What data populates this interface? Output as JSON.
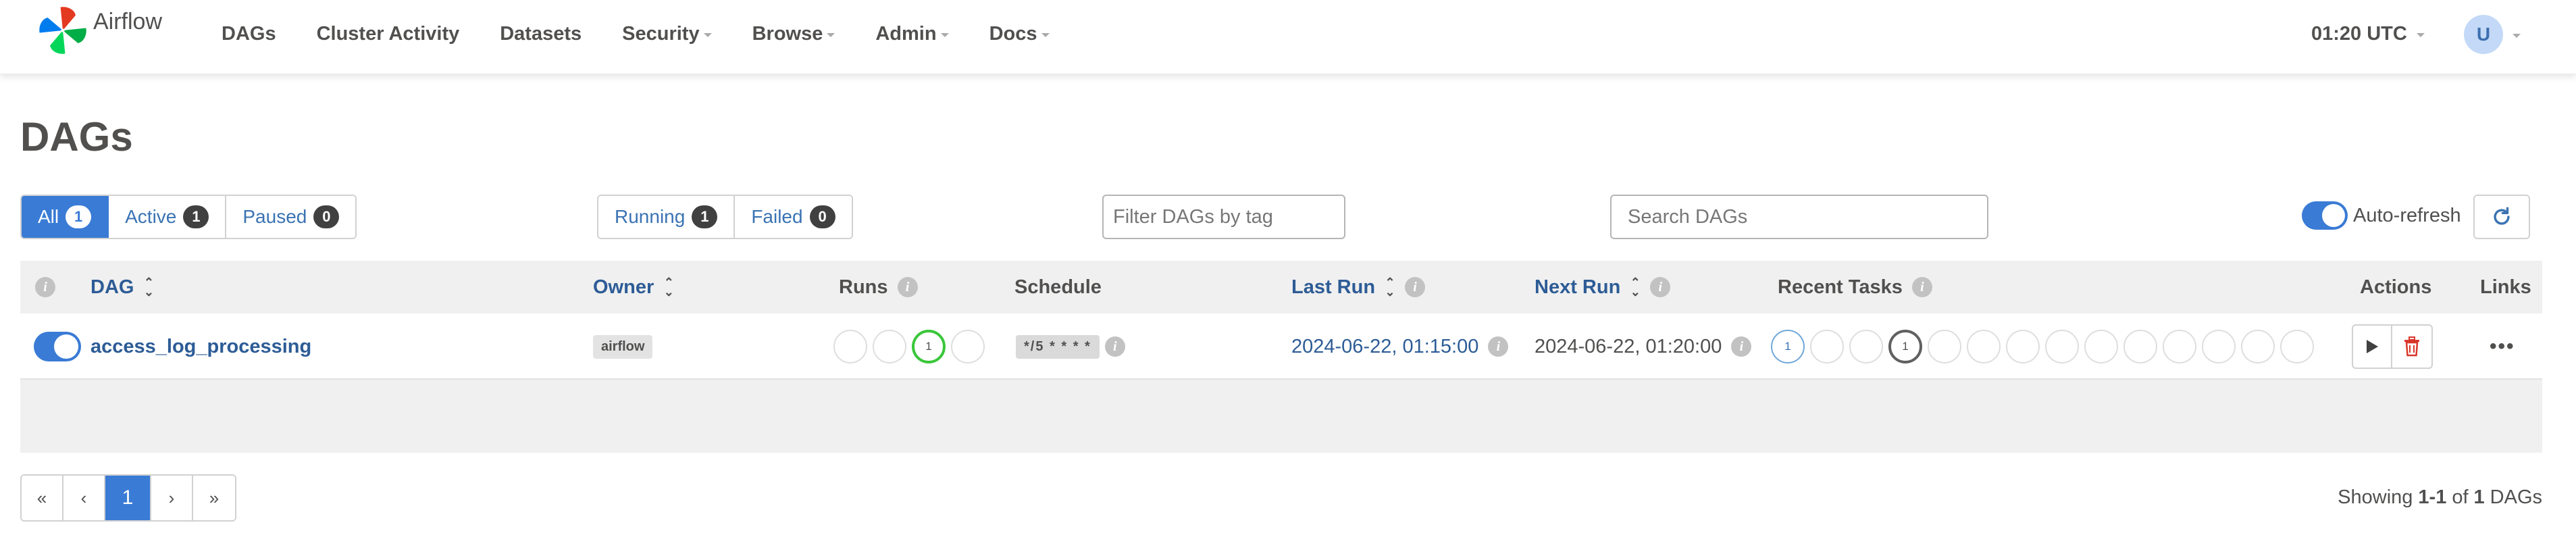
{
  "navbar": {
    "brand": "Airflow",
    "items": [
      "DAGs",
      "Cluster Activity",
      "Datasets",
      "Security",
      "Browse",
      "Admin",
      "Docs"
    ],
    "time": "01:20 UTC",
    "avatar_initial": "U",
    "colors": {
      "accent": "#3a7bd5",
      "link": "#2d5c96"
    }
  },
  "page_title": "DAGs",
  "status_filters": {
    "all": {
      "label": "All",
      "count": "1"
    },
    "active": {
      "label": "Active",
      "count": "1"
    },
    "paused": {
      "label": "Paused",
      "count": "0"
    }
  },
  "run_filters": {
    "running": {
      "label": "Running",
      "count": "1"
    },
    "failed": {
      "label": "Failed",
      "count": "0"
    }
  },
  "tag_filter": {
    "placeholder": "Filter DAGs by tag"
  },
  "search": {
    "placeholder": "Search DAGs"
  },
  "auto_refresh": {
    "label": "Auto-refresh",
    "enabled": true
  },
  "table": {
    "headers": {
      "dag": "DAG",
      "owner": "Owner",
      "runs": "Runs",
      "schedule": "Schedule",
      "last_run": "Last Run",
      "next_run": "Next Run",
      "recent_tasks": "Recent Tasks",
      "actions": "Actions",
      "links": "Links"
    },
    "rows": [
      {
        "enabled": true,
        "dag_id": "access_log_processing",
        "owner": "airflow",
        "runs": [
          "",
          "",
          "1",
          ""
        ],
        "runs_states": [
          "none",
          "none",
          "success",
          "none"
        ],
        "schedule": "*/5 * * * *",
        "last_run": "2024-06-22, 01:15:00",
        "next_run": "2024-06-22, 01:20:00",
        "recent_tasks": [
          "1",
          "",
          "",
          "1",
          "",
          "",
          "",
          "",
          "",
          "",
          "",
          "",
          "",
          ""
        ],
        "recent_tasks_states": [
          "queued",
          "none",
          "none",
          "running",
          "none",
          "none",
          "none",
          "none",
          "none",
          "none",
          "none",
          "none",
          "none",
          "none"
        ]
      }
    ]
  },
  "pagination": {
    "first": "«",
    "prev": "‹",
    "current": "1",
    "next": "›",
    "last": "»"
  },
  "showing": {
    "prefix": "Showing",
    "range": "1-1",
    "of": "of",
    "total": "1",
    "suffix": "DAGs"
  }
}
